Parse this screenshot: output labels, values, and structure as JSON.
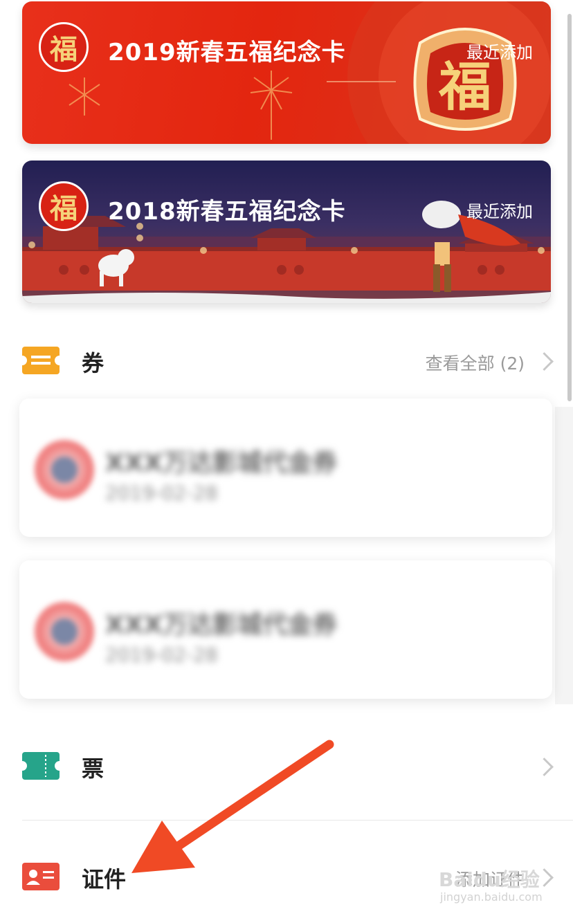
{
  "cards": [
    {
      "badge": "福",
      "title": "2019新春五福纪念卡",
      "tag": "最近添加"
    },
    {
      "badge": "福",
      "title": "2018新春五福纪念卡",
      "tag": "最近添加"
    }
  ],
  "coupons_section": {
    "label": "券",
    "view_all": "查看全部 (2)"
  },
  "coupons": [
    {
      "name": "XXX万达影城代金券",
      "sub": "2019-02-28"
    },
    {
      "name": "XXX万达影城代金券",
      "sub": "2019-02-28"
    }
  ],
  "tickets_section": {
    "label": "票"
  },
  "id_section": {
    "label": "证件",
    "action": "添加证件"
  },
  "watermark": {
    "brand": "Baidu经验",
    "url": "jingyan.baidu.com"
  },
  "colors": {
    "coupon_icon": "#f5a623",
    "ticket_icon": "#26a48a",
    "id_icon": "#ea4d3c",
    "arrow": "#f04a25",
    "card_2019": "#e3260f",
    "card_2018": "#2a2457"
  },
  "icons": {
    "coupon": "coupon-ticket-icon",
    "ticket": "ticket-stub-icon",
    "id": "id-card-icon",
    "chevron": "chevron-right-icon"
  }
}
